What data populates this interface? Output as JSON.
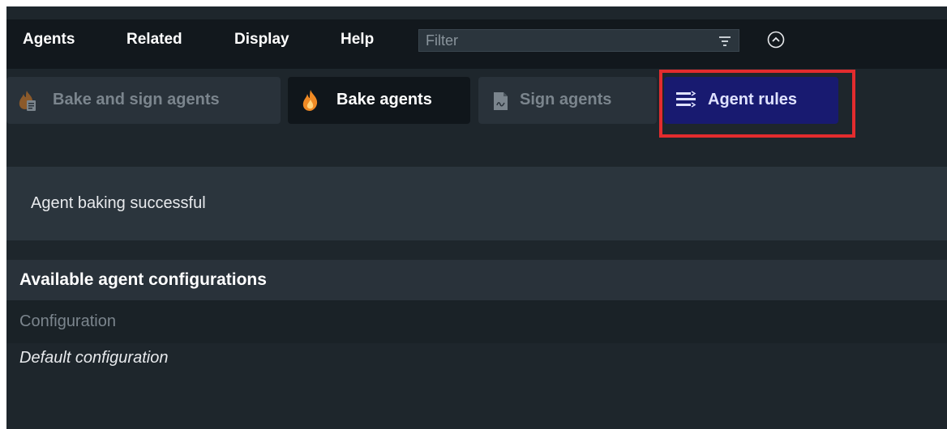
{
  "menu": {
    "agents": "Agents",
    "related": "Related",
    "display": "Display",
    "help": "Help"
  },
  "filter": {
    "placeholder": "Filter",
    "value": "",
    "icon": "filter-icon"
  },
  "collapse": {
    "icon": "chevron-up-circle-icon"
  },
  "tabs": [
    {
      "label": "Bake and sign agents",
      "icon": "flame-document-icon",
      "state": "disabled"
    },
    {
      "label": "Bake agents",
      "icon": "flame-icon",
      "state": "enabled"
    },
    {
      "label": "Sign agents",
      "icon": "document-icon",
      "state": "disabled"
    },
    {
      "label": "Agent rules",
      "icon": "rules-list-icon",
      "state": "highlighted"
    }
  ],
  "message": {
    "text": "Agent baking successful"
  },
  "configurations": {
    "title": "Available agent configurations",
    "column": "Configuration",
    "rows": [
      {
        "name": "Default configuration"
      }
    ]
  },
  "colors": {
    "background": "#1e262c",
    "menubar": "#12181d",
    "tab_inactive": "#29323a",
    "tab_active": "#10161b",
    "rules_tab": "#181a70",
    "highlight": "#e32c2e",
    "flame": "#f08a24"
  }
}
